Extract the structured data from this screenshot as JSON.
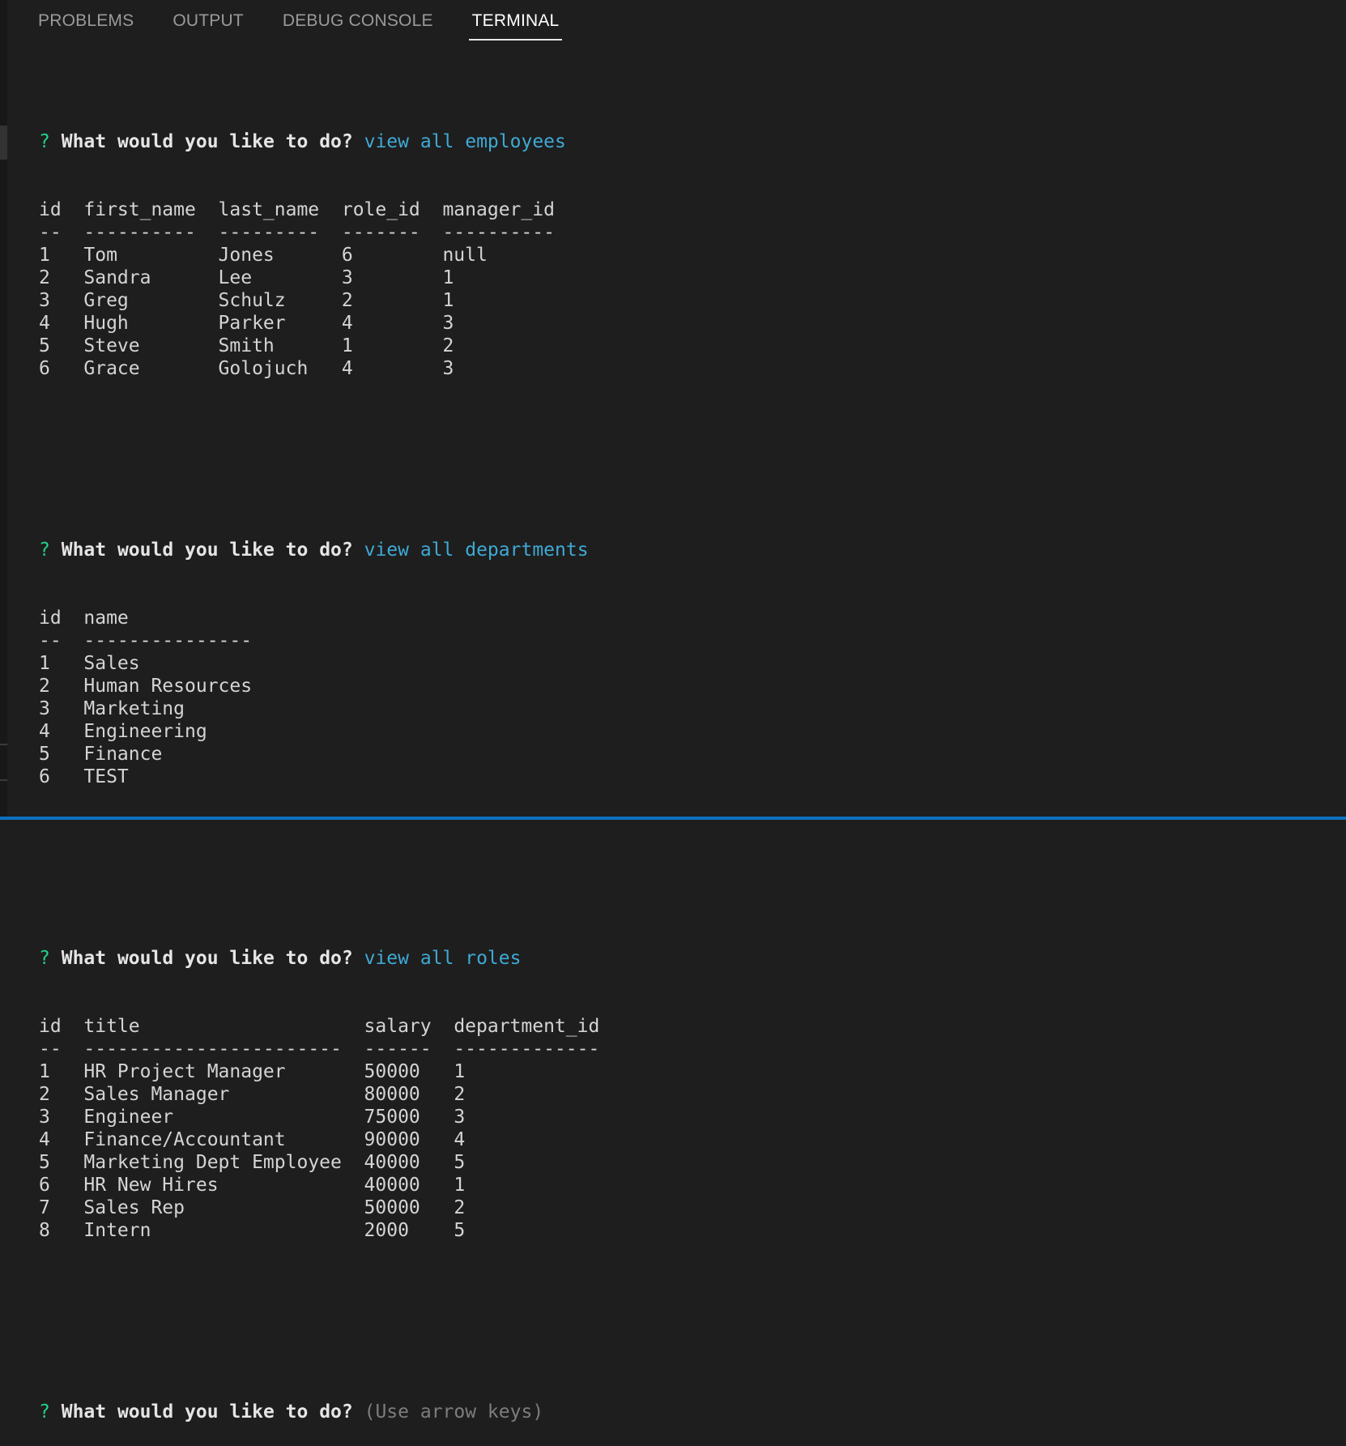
{
  "tabs": [
    {
      "label": "PROBLEMS"
    },
    {
      "label": "OUTPUT"
    },
    {
      "label": "DEBUG CONSOLE"
    },
    {
      "label": "TERMINAL"
    }
  ],
  "prompt": {
    "mark": "?",
    "question": "What would you like to do?"
  },
  "employees": {
    "answer": "view all employees",
    "headers": [
      "id",
      "first_name",
      "last_name",
      "role_id",
      "manager_id"
    ],
    "dashes": [
      "--",
      "----------",
      "---------",
      "-------",
      "----------"
    ],
    "rows": [
      [
        "1",
        "Tom",
        "Jones",
        "6",
        "null"
      ],
      [
        "2",
        "Sandra",
        "Lee",
        "3",
        "1"
      ],
      [
        "3",
        "Greg",
        "Schulz",
        "2",
        "1"
      ],
      [
        "4",
        "Hugh",
        "Parker",
        "4",
        "3"
      ],
      [
        "5",
        "Steve",
        "Smith",
        "1",
        "2"
      ],
      [
        "6",
        "Grace",
        "Golojuch",
        "4",
        "3"
      ]
    ]
  },
  "departments": {
    "answer": "view all departments",
    "headers": [
      "id",
      "name"
    ],
    "dashes": [
      "--",
      "---------------"
    ],
    "rows": [
      [
        "1",
        "Sales"
      ],
      [
        "2",
        "Human Resources"
      ],
      [
        "3",
        "Marketing"
      ],
      [
        "4",
        "Engineering"
      ],
      [
        "5",
        "Finance"
      ],
      [
        "6",
        "TEST"
      ]
    ]
  },
  "roles": {
    "answer": "view all roles",
    "headers": [
      "id",
      "title",
      "salary",
      "department_id"
    ],
    "dashes": [
      "--",
      "-----------------------",
      "------",
      "-------------"
    ],
    "rows": [
      [
        "1",
        "HR Project Manager",
        "50000",
        "1"
      ],
      [
        "2",
        "Sales Manager",
        "80000",
        "2"
      ],
      [
        "3",
        "Engineer",
        "75000",
        "3"
      ],
      [
        "4",
        "Finance/Accountant",
        "90000",
        "4"
      ],
      [
        "5",
        "Marketing Dept Employee",
        "40000",
        "5"
      ],
      [
        "6",
        "HR New Hires",
        "40000",
        "1"
      ],
      [
        "7",
        "Sales Rep",
        "50000",
        "2"
      ],
      [
        "8",
        "Intern",
        "2000",
        "5"
      ]
    ]
  },
  "final_prompt": {
    "hint": "(Use arrow keys)"
  },
  "colors": {
    "background": "#1e1e1e",
    "prompt_mark": "#23d18b",
    "answer": "#3fa9d5",
    "hint": "#7d7d7d",
    "accent_bar": "#0e70c0"
  }
}
